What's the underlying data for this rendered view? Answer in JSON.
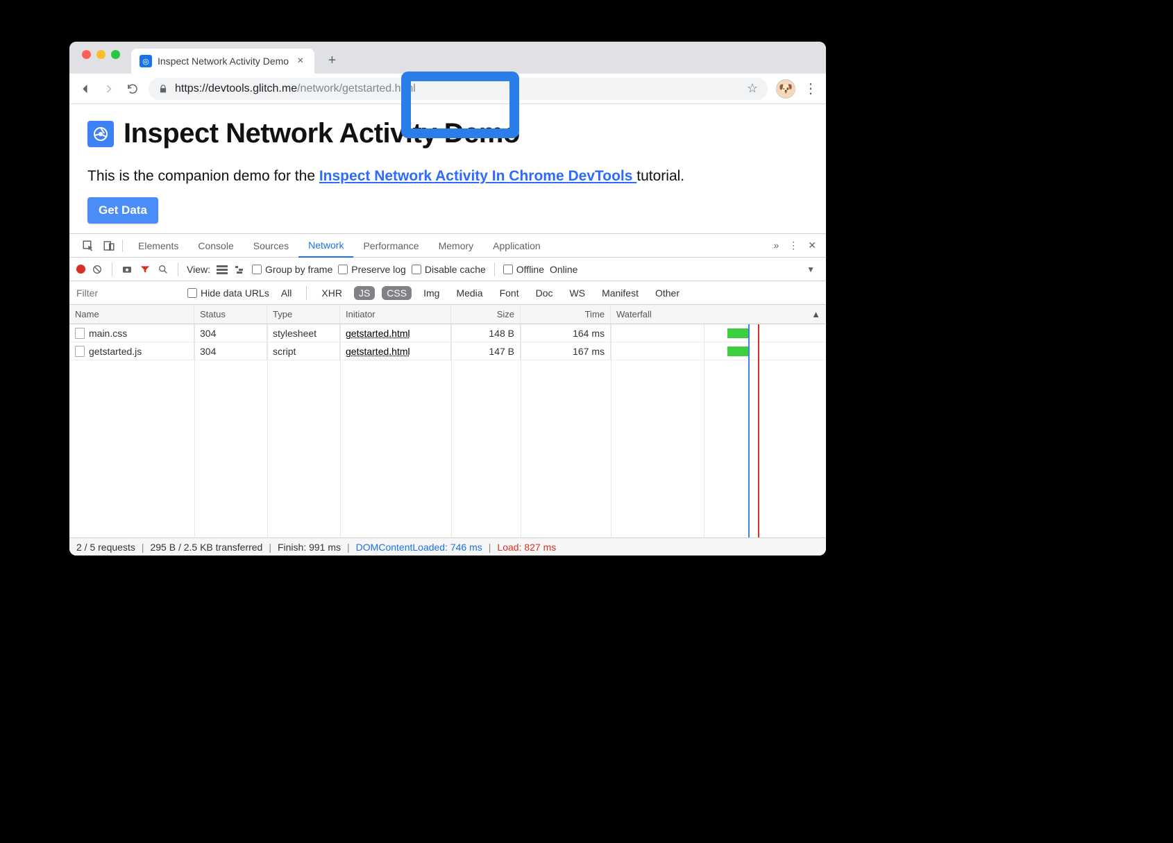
{
  "browser": {
    "tab_title": "Inspect Network Activity Demo",
    "url_secure_prefix": "https://",
    "url_host": "devtools.glitch.me",
    "url_path": "/network/getstarted.html"
  },
  "page": {
    "heading": "Inspect Network Activity Demo",
    "sub_pre": "This is the companion demo for the ",
    "sub_link": "Inspect Network Activity In Chrome DevTools ",
    "sub_post": "tutorial.",
    "button": "Get Data"
  },
  "devtools": {
    "tabs": [
      "Elements",
      "Console",
      "Sources",
      "Network",
      "Performance",
      "Memory",
      "Application"
    ],
    "active_tab": "Network",
    "toolbar": {
      "view_label": "View:",
      "group_by_frame": "Group by frame",
      "preserve_log": "Preserve log",
      "disable_cache": "Disable cache",
      "offline": "Offline",
      "online": "Online"
    },
    "filterbar": {
      "placeholder": "Filter",
      "hide_data_urls": "Hide data URLs",
      "types": [
        "All",
        "XHR",
        "JS",
        "CSS",
        "Img",
        "Media",
        "Font",
        "Doc",
        "WS",
        "Manifest",
        "Other"
      ],
      "selected": [
        "JS",
        "CSS"
      ]
    },
    "columns": [
      "Name",
      "Status",
      "Type",
      "Initiator",
      "Size",
      "Time",
      "Waterfall"
    ],
    "rows": [
      {
        "name": "main.css",
        "status": "304",
        "type": "stylesheet",
        "initiator": "getstarted.html",
        "size": "148 B",
        "time": "164 ms"
      },
      {
        "name": "getstarted.js",
        "status": "304",
        "type": "script",
        "initiator": "getstarted.html",
        "size": "147 B",
        "time": "167 ms"
      }
    ],
    "status": {
      "requests": "2 / 5 requests",
      "transferred": "295 B / 2.5 KB transferred",
      "finish": "Finish: 991 ms",
      "domcontent": "DOMContentLoaded: 746 ms",
      "load": "Load: 827 ms"
    }
  }
}
